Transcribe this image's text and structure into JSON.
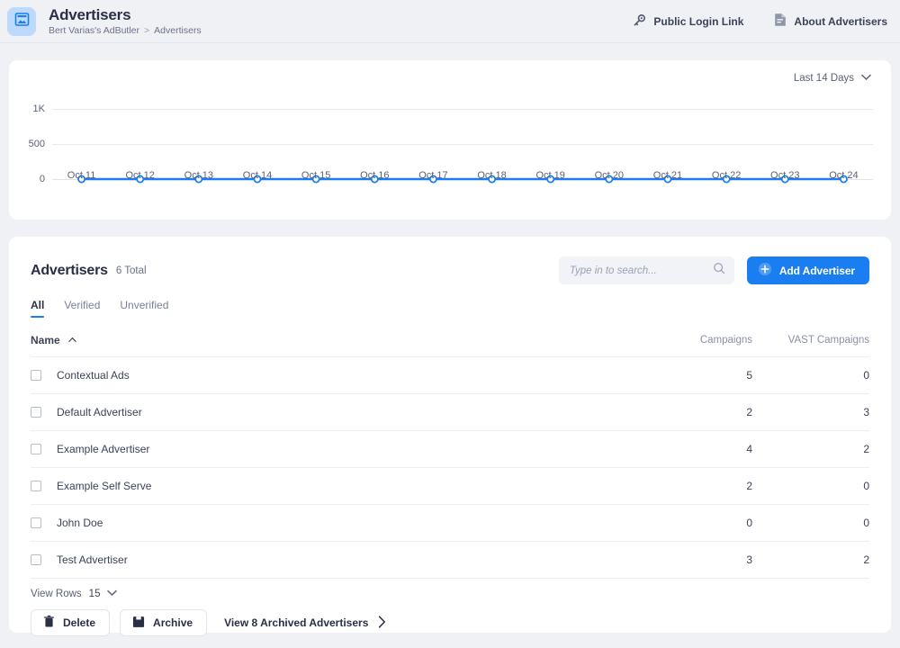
{
  "header": {
    "logo_icon": "ad-banner-icon",
    "title": "Advertisers",
    "breadcrumb": {
      "root": "Bert Varias's AdButler",
      "separator": ">",
      "current": "Advertisers"
    },
    "actions": [
      {
        "label": "Public Login Link",
        "icon": "key-icon"
      },
      {
        "label": "About Advertisers",
        "icon": "document-icon"
      }
    ]
  },
  "chart_panel": {
    "range_label": "Last 14 Days",
    "range_icon": "chevron-down-icon"
  },
  "chart_data": {
    "type": "line",
    "title": "",
    "xlabel": "",
    "ylabel": "",
    "categories": [
      "Oct 11",
      "Oct 12",
      "Oct 13",
      "Oct 14",
      "Oct 15",
      "Oct 16",
      "Oct 17",
      "Oct 18",
      "Oct 19",
      "Oct 20",
      "Oct 21",
      "Oct 22",
      "Oct 23",
      "Oct 24"
    ],
    "values": [
      0,
      0,
      0,
      0,
      0,
      0,
      0,
      0,
      0,
      0,
      0,
      0,
      0,
      0
    ],
    "ytick_labels": [
      "1K",
      "500",
      "0"
    ],
    "ytick_values": [
      1000,
      500,
      0
    ],
    "ylim": [
      0,
      1000
    ],
    "grid": true,
    "legend": "none",
    "line_color": "#1a7ef0",
    "marker": "circle"
  },
  "list": {
    "title": "Advertisers",
    "count_label": "6 Total",
    "search": {
      "placeholder": "Type in to search...",
      "value": "",
      "icon": "search-icon"
    },
    "add_button": {
      "label": "Add Advertiser",
      "icon": "plus-circle-icon"
    },
    "tabs": [
      {
        "label": "All",
        "active": true
      },
      {
        "label": "Verified",
        "active": false
      },
      {
        "label": "Unverified",
        "active": false
      }
    ],
    "columns": {
      "name": "Name",
      "sort_icon": "caret-up-icon",
      "campaigns": "Campaigns",
      "vast_campaigns": "VAST Campaigns"
    },
    "rows": [
      {
        "name": "Contextual Ads",
        "campaigns": "5",
        "vast": "0"
      },
      {
        "name": "Default Advertiser",
        "campaigns": "2",
        "vast": "3"
      },
      {
        "name": "Example Advertiser",
        "campaigns": "4",
        "vast": "2"
      },
      {
        "name": "Example Self Serve",
        "campaigns": "2",
        "vast": "0"
      },
      {
        "name": "John Doe",
        "campaigns": "0",
        "vast": "0"
      },
      {
        "name": "Test Advertiser",
        "campaigns": "3",
        "vast": "2"
      }
    ]
  },
  "footer": {
    "view_rows_label": "View Rows",
    "view_rows_value": "15",
    "view_rows_icon": "chevron-down-icon",
    "delete_button": {
      "label": "Delete",
      "icon": "trash-icon"
    },
    "archive_button": {
      "label": "Archive",
      "icon": "archive-box-icon"
    },
    "archived_link": {
      "label": "View 8 Archived Advertisers",
      "icon": "chevron-right-icon"
    }
  },
  "colors": {
    "accent": "#1a7ef0",
    "page_bg": "#f0f1f5",
    "card_bg": "#ffffff",
    "text": "#3c4257",
    "muted": "#8a90a6"
  }
}
